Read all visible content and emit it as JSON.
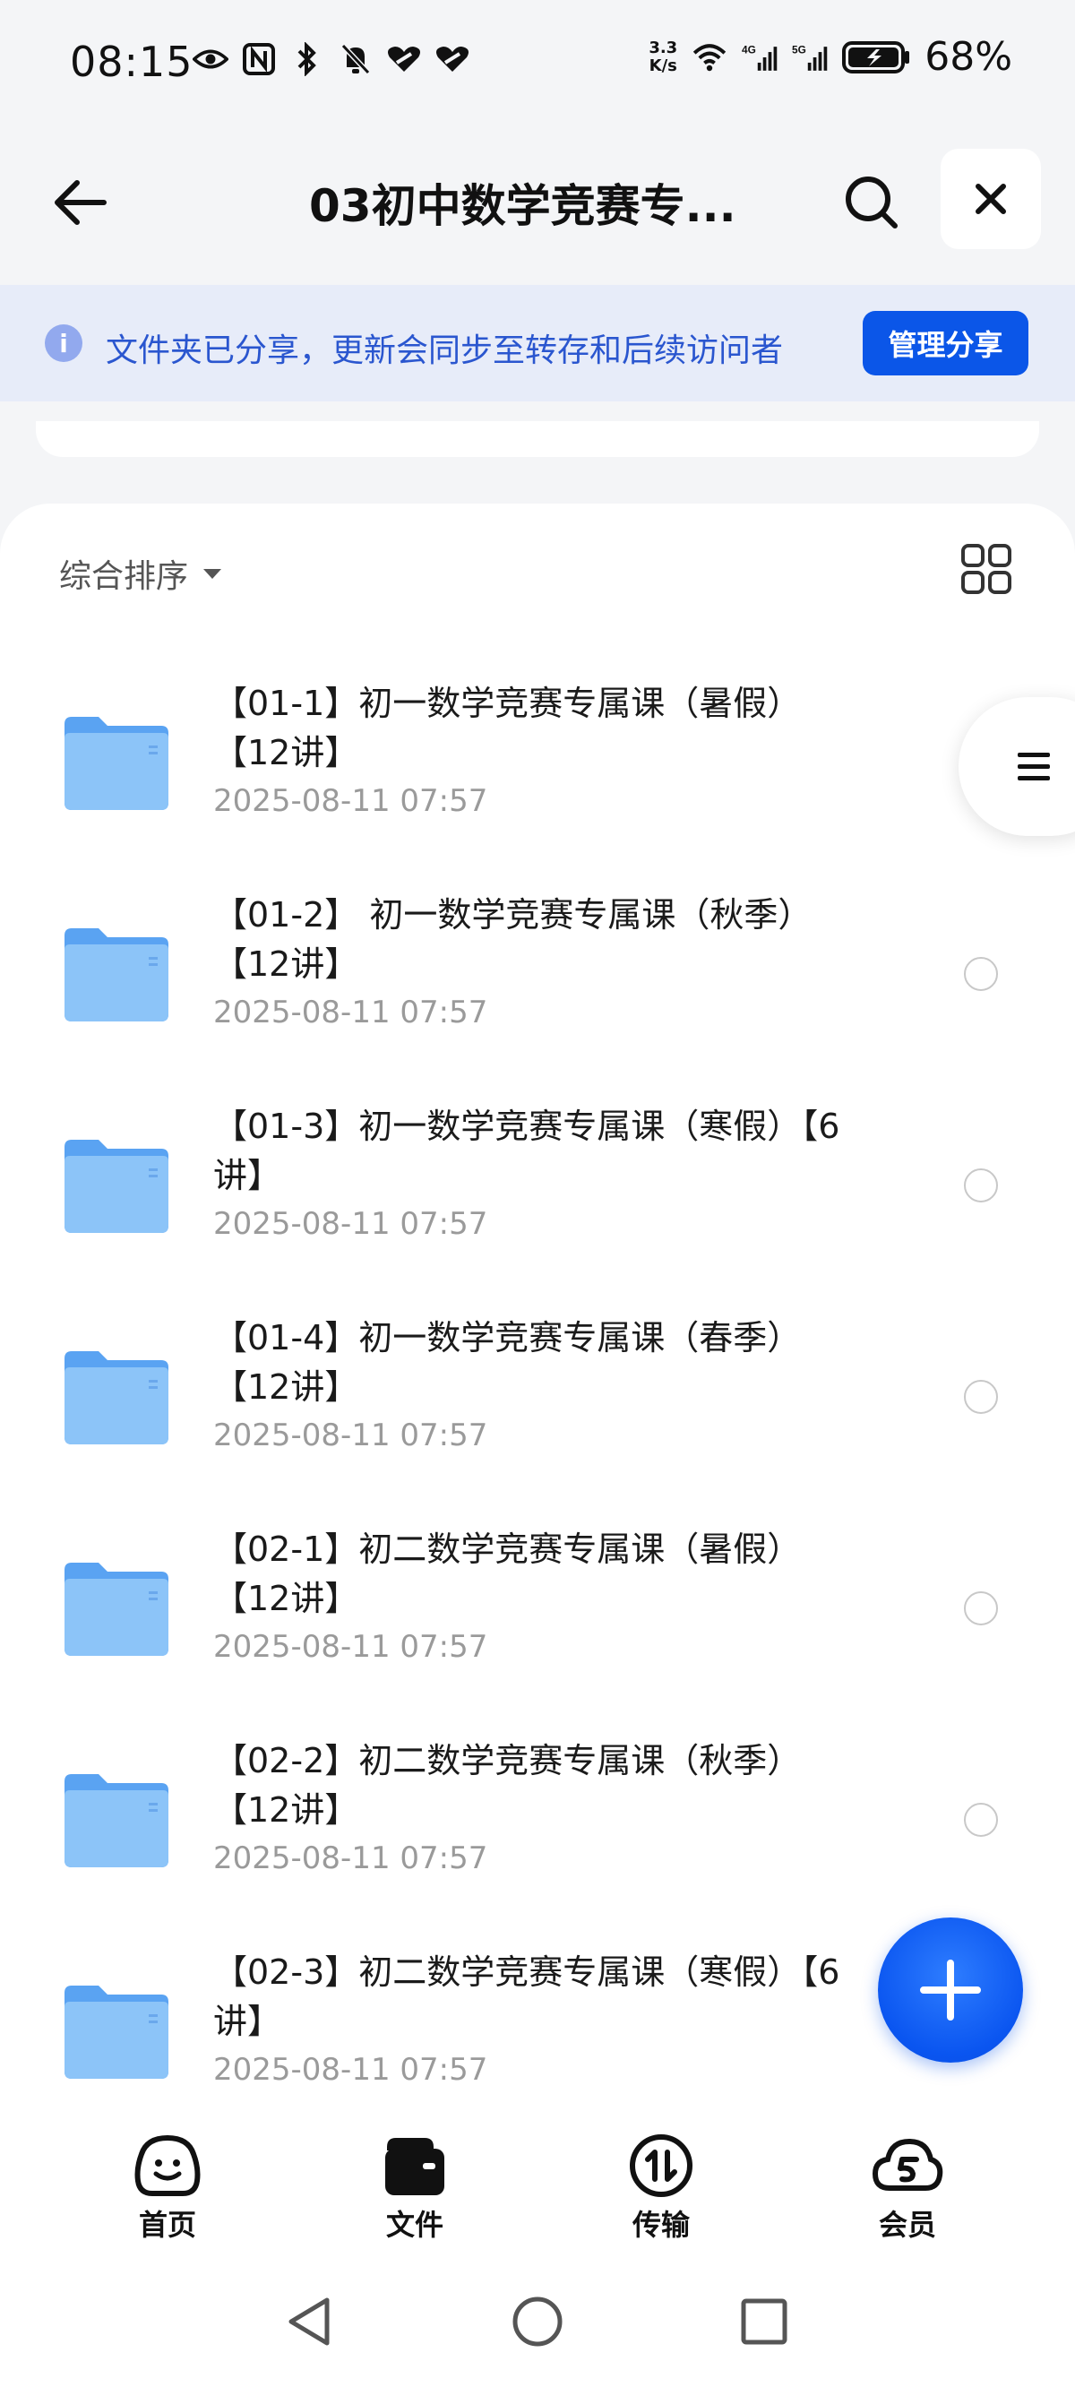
{
  "status_bar": {
    "time": "08:15",
    "net_speed_top": "3.3",
    "net_speed_bottom": "K/s",
    "battery_percent": "68%",
    "left_icons": [
      "eye-icon",
      "nfc-icon",
      "bluetooth-icon",
      "bell-off-icon",
      "heart-link-icon",
      "heart-link-icon"
    ],
    "right_icons": [
      "wifi-icon",
      "signal-4g-icon",
      "signal-5g-icon",
      "battery-charging-icon"
    ]
  },
  "header": {
    "title": "03初中数学竞赛专...",
    "back_icon": "back-arrow-icon",
    "search_icon": "search-icon",
    "close_icon": "close-icon"
  },
  "share_banner": {
    "info_glyph": "i",
    "text": "文件夹已分享，更新会同步至转存和后续访问者",
    "button_label": "管理分享"
  },
  "sort": {
    "label": "综合排序"
  },
  "files": [
    {
      "name": "【01-1】初一数学竞赛专属课（暑假）【12讲】",
      "date": "2025-08-11 07:57"
    },
    {
      "name": "【01-2】 初一数学竞赛专属课（秋季）【12讲】",
      "date": "2025-08-11 07:57"
    },
    {
      "name": "【01-3】初一数学竞赛专属课（寒假）【6讲】",
      "date": "2025-08-11 07:57"
    },
    {
      "name": "【01-4】初一数学竞赛专属课（春季）【12讲】",
      "date": "2025-08-11 07:57"
    },
    {
      "name": "【02-1】初二数学竞赛专属课（暑假）【12讲】",
      "date": "2025-08-11 07:57"
    },
    {
      "name": "【02-2】初二数学竞赛专属课（秋季）【12讲】",
      "date": "2025-08-11 07:57"
    },
    {
      "name": "【02-3】初二数学竞赛专属课（寒假）【6讲】",
      "date": "2025-08-11 07:57"
    }
  ],
  "bottom_nav": [
    {
      "label": "首页",
      "icon": "home-face-icon"
    },
    {
      "label": "文件",
      "icon": "wallet-folder-icon"
    },
    {
      "label": "传输",
      "icon": "transfer-icon"
    },
    {
      "label": "会员",
      "icon": "cloud-vip-icon"
    }
  ],
  "colors": {
    "accent": "#0b56e8",
    "banner_bg": "#e7ecf9",
    "banner_text": "#2a56cf",
    "folder": "#7bb8f7"
  }
}
